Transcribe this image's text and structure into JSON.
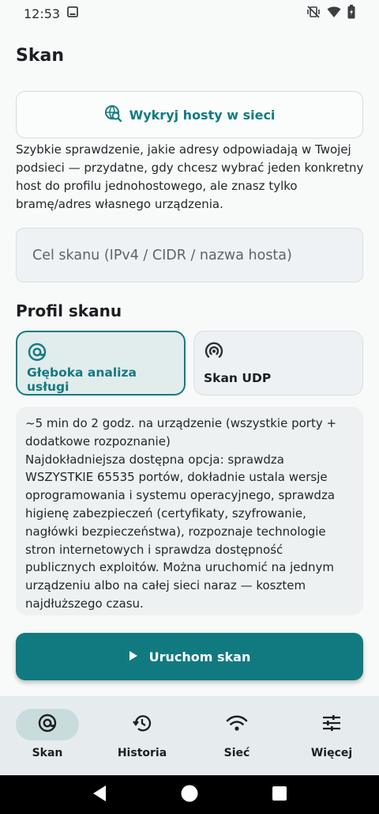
{
  "status": {
    "time": "12:53"
  },
  "page": {
    "title": "Skan"
  },
  "discover": {
    "label": "Wykryj hosty w sieci",
    "description": "Szybkie sprawdzenie, jakie adresy odpowiadają w Twojej podsieci — przydatne, gdy chcesz wybrać jeden konkretny host do profilu jednohostowego, ale znasz tylko bramę/adres własnego urządzenia."
  },
  "target": {
    "placeholder": "Cel skanu (IPv4 / CIDR / nazwa hosta)"
  },
  "profile": {
    "title": "Profil skanu",
    "options": [
      {
        "label": "Głęboka analiza usługi",
        "icon": "at-icon",
        "selected": true
      },
      {
        "label": "Skan UDP",
        "icon": "radar-icon",
        "selected": false
      }
    ],
    "info_line1": "~5 min do 2 godz. na urządzenie (wszystkie porty + dodatkowe rozpoznanie)",
    "info_line2": "Najdokładniejsza dostępna opcja: sprawdza WSZYSTKIE 65535 portów, dokładnie ustala wersje oprogramowania i systemu operacyjnego, sprawdza higienę zabezpieczeń (certyfikaty, szyfrowanie, nagłówki bezpieczeństwa), rozpoznaje technologie stron internetowych i sprawdza dostępność publicznych exploitów. Można uruchomić na jednym urządzeniu albo na całej sieci naraz — kosztem najdłuższego czasu."
  },
  "run": {
    "label": "Uruchom skan"
  },
  "nav": {
    "items": [
      {
        "label": "Skan",
        "icon": "at-icon",
        "active": true
      },
      {
        "label": "Historia",
        "icon": "history-icon",
        "active": false
      },
      {
        "label": "Sieć",
        "icon": "wifi-icon",
        "active": false
      },
      {
        "label": "Więcej",
        "icon": "sliders-icon",
        "active": false
      }
    ]
  },
  "colors": {
    "accent": "#117a80",
    "background": "#f8fafa",
    "nav_background": "#e6eced"
  }
}
